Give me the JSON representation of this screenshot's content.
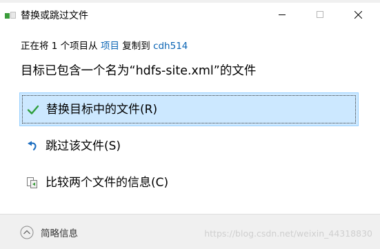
{
  "window": {
    "title": "替换或跳过文件"
  },
  "message": {
    "prefix": "正在将 1 个项目从 ",
    "source": "项目",
    "middle": " 复制到 ",
    "destination": "cdh514",
    "headline": "目标已包含一个名为“hdfs-site.xml”的文件"
  },
  "options": [
    {
      "label": "替换目标中的文件(R)",
      "icon": "check-icon",
      "selected": true
    },
    {
      "label": "跳过该文件(S)",
      "icon": "undo-arrow-icon",
      "selected": false
    },
    {
      "label": "比较两个文件的信息(C)",
      "icon": "compare-files-icon",
      "selected": false
    }
  ],
  "footer": {
    "details_label": "简略信息",
    "watermark": "https://blog.csdn.net/weixin_44318830"
  },
  "colors": {
    "link": "#0a64b4",
    "selected_bg": "#cce8ff",
    "selected_border": "#99d1ff",
    "check": "#2e9e3c",
    "undo": "#1e6fc1"
  }
}
